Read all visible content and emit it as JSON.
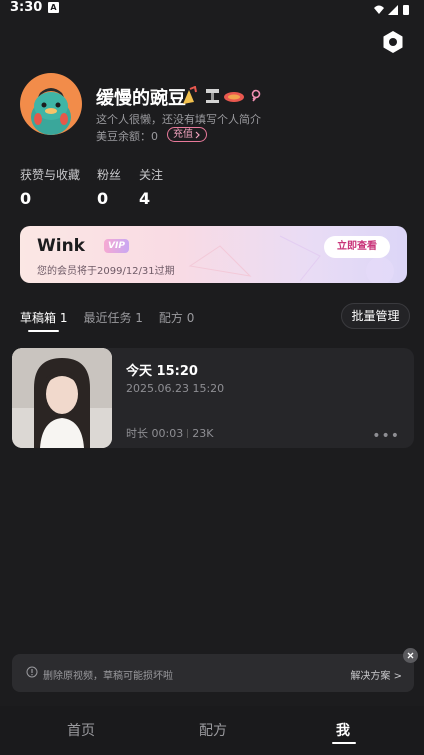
{
  "status_bar": {
    "time": "3:30",
    "notification_icon": "A"
  },
  "profile": {
    "username": "缓慢的豌豆",
    "bio": "这个人很懒，还没有填写个人简介",
    "balance_label": "美豆余额：0",
    "recharge_label": "充值"
  },
  "stats": [
    {
      "label": "获赞与收藏",
      "value": "0"
    },
    {
      "label": "粉丝",
      "value": "0"
    },
    {
      "label": "关注",
      "value": "4"
    }
  ],
  "vip": {
    "brand": "Wink",
    "tag": "VIP",
    "expire_text": "您的会员将于2099/12/31过期",
    "button_label": "立即查看"
  },
  "tabs": [
    {
      "label": "草稿箱 1",
      "active": true
    },
    {
      "label": "最近任务 1",
      "active": false
    },
    {
      "label": "配方 0",
      "active": false
    }
  ],
  "batch_button": "批量管理",
  "draft": {
    "title": "今天 15:20",
    "date": "2025.06.23 15:20",
    "duration": "时长 00:03",
    "size": "23K",
    "more": "•••"
  },
  "toast": {
    "text": "删除原视频，草稿可能损坏啦",
    "link": "解决方案 >"
  },
  "nav": [
    {
      "label": "首页",
      "active": false
    },
    {
      "label": "配方",
      "active": false
    },
    {
      "label": "我",
      "active": true
    }
  ],
  "colors": {
    "background": "#1c1c1e",
    "accent_pink": "#e8799a",
    "card": "#262629"
  }
}
